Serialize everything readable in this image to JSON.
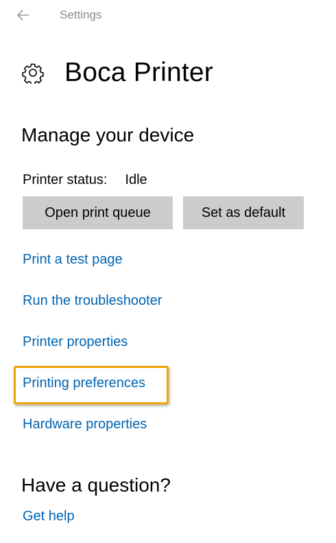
{
  "title_bar": {
    "app_title": "Settings"
  },
  "header": {
    "title": "Boca Printer"
  },
  "manage": {
    "heading": "Manage your device",
    "status_label": "Printer status:",
    "status_value": "Idle",
    "buttons": {
      "open_queue": "Open print queue",
      "set_default": "Set as default"
    },
    "links": [
      "Print a test page",
      "Run the troubleshooter",
      "Printer properties",
      "Printing preferences",
      "Hardware properties"
    ],
    "highlighted_link": "Printing preferences"
  },
  "question": {
    "heading": "Have a question?",
    "link": "Get help"
  },
  "colors": {
    "link": "#0063b1",
    "button_bg": "#cccccc",
    "highlight": "#f0a30a",
    "muted": "#8a8a8a"
  },
  "icons": {
    "back": "arrow-left-icon",
    "settings": "gear-icon"
  }
}
